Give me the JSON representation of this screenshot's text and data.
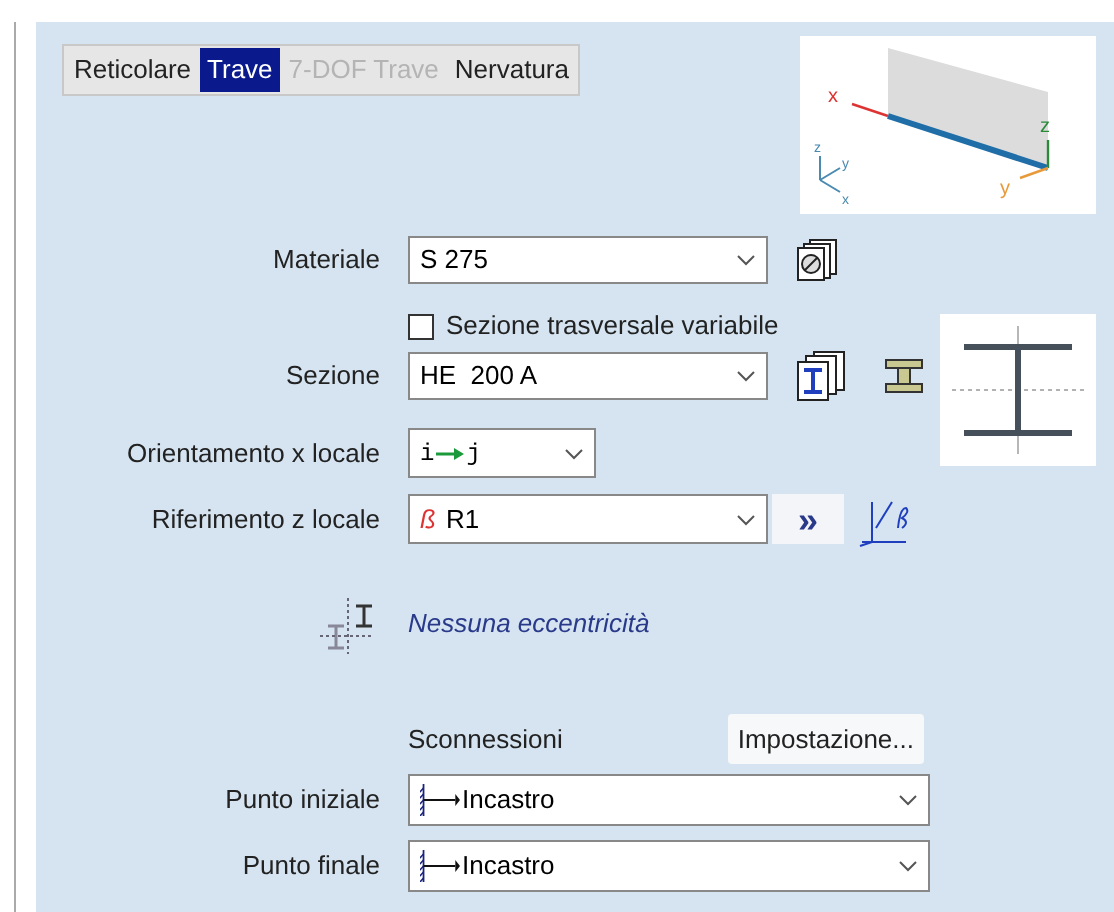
{
  "tabs": [
    {
      "label": "Reticolare",
      "selected": false,
      "disabled": false
    },
    {
      "label": "Trave",
      "selected": true,
      "disabled": false
    },
    {
      "label": "7-DOF Trave",
      "selected": false,
      "disabled": true
    },
    {
      "label": "Nervatura",
      "selected": false,
      "disabled": false
    }
  ],
  "axes_diagram": {
    "beam_x": "x",
    "beam_z": "z",
    "beam_y": "y",
    "global_z": "z",
    "global_y": "y",
    "global_x": "x"
  },
  "material": {
    "label": "Materiale",
    "value": "S 275"
  },
  "variable_section": {
    "label": "Sezione trasversale variabile",
    "checked": false
  },
  "section": {
    "label": "Sezione",
    "value": "HE  200 A"
  },
  "orientation": {
    "label": "Orientamento x locale",
    "from": "i",
    "to": "j"
  },
  "z_reference": {
    "label": "Riferimento z locale",
    "symbol": "ß",
    "value": "R1",
    "more_button": "»"
  },
  "eccentricity": {
    "text": "Nessuna eccentricità"
  },
  "releases": {
    "title": "Sconnessioni",
    "settings_button": "Impostazione..."
  },
  "end_points": [
    {
      "label": "Punto iniziale",
      "value": "Incastro"
    },
    {
      "label": "Punto finale",
      "value": "Incastro"
    }
  ]
}
